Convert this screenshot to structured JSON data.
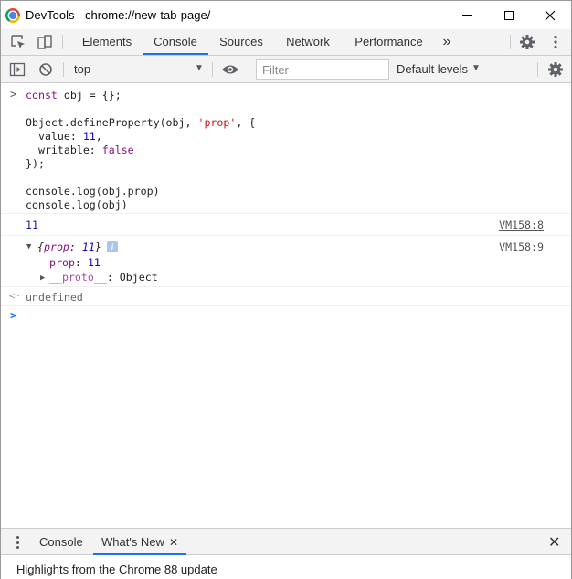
{
  "window": {
    "title": "DevTools - chrome://new-tab-page/"
  },
  "tabs": [
    {
      "label": "Elements"
    },
    {
      "label": "Console",
      "active": true
    },
    {
      "label": "Sources"
    },
    {
      "label": "Network"
    },
    {
      "label": "Performance"
    }
  ],
  "tabs_overflow": "»",
  "toolbar": {
    "context": "top",
    "filter_placeholder": "Filter",
    "levels": "Default levels"
  },
  "console": {
    "input_lines": [
      "const obj = {};",
      "",
      "Object.defineProperty(obj, 'prop', {",
      "  value: 11,",
      "  writable: false",
      "});",
      "",
      "console.log(obj.prop)",
      "console.log(obj)"
    ],
    "log1": {
      "value": "11",
      "source": "VM158:8"
    },
    "log2": {
      "summary_open": "{",
      "summary_key": "prop",
      "summary_sep": ": ",
      "summary_value": "11",
      "summary_close": "}",
      "info_badge": "i",
      "source": "VM158:9",
      "prop_key": "prop",
      "prop_sep": ": ",
      "prop_value": "11",
      "proto_key": "__proto__",
      "proto_sep": ": ",
      "proto_value": "Object"
    },
    "result": "undefined"
  },
  "drawer": {
    "tabs": [
      {
        "label": "Console"
      },
      {
        "label": "What's New",
        "active": true,
        "close": "✕"
      }
    ],
    "close": "✕",
    "content": "Highlights from the Chrome 88 update"
  },
  "colors": {
    "accent": "#1a73e8",
    "keyword": "#881280",
    "number": "#1c00cf",
    "string": "#c41a16"
  },
  "icons": [
    "chrome-logo-icon",
    "inspect-element-icon",
    "device-toolbar-icon",
    "settings-icon",
    "more-vert-icon",
    "sidebar-toggle-icon",
    "clear-console-icon",
    "eye-icon",
    "console-settings-icon"
  ]
}
